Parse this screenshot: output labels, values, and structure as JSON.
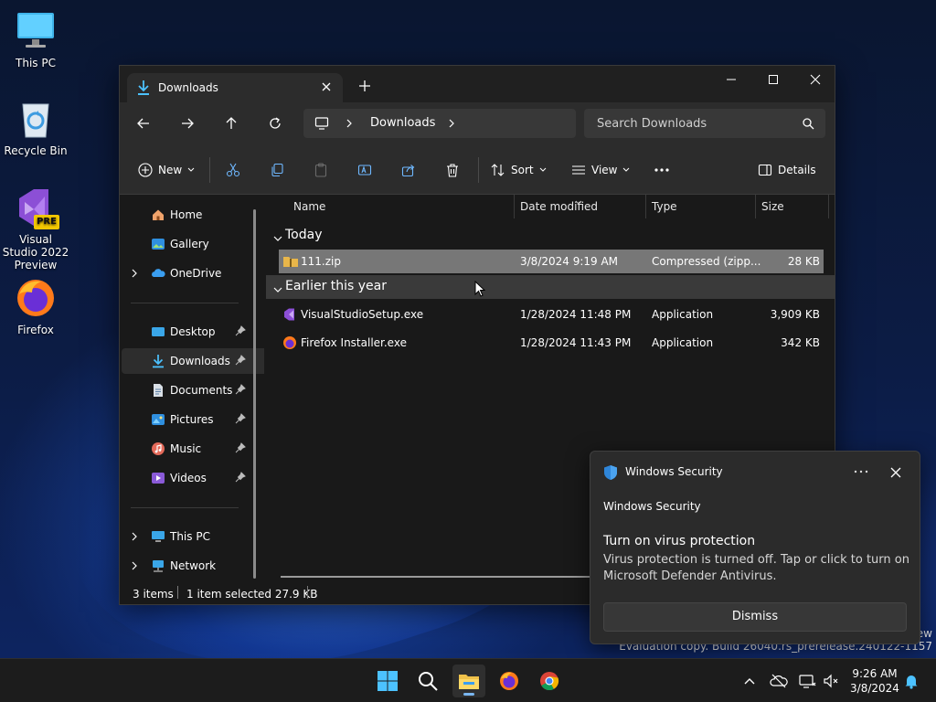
{
  "desktop": {
    "icons": [
      {
        "label": "This PC"
      },
      {
        "label": "Recycle Bin"
      },
      {
        "label": "Visual Studio 2022 Preview",
        "badge": "PRE"
      },
      {
        "label": "Firefox"
      }
    ],
    "watermark": {
      "line1": "ew",
      "line2": "Evaluation copy. Build 26040.rs_prerelease.240122-1157"
    }
  },
  "explorer": {
    "tab": {
      "title": "Downloads"
    },
    "address": {
      "segment": "Downloads"
    },
    "search": {
      "placeholder": "Search Downloads"
    },
    "toolbar": {
      "new_label": "New",
      "sort_label": "Sort",
      "view_label": "View",
      "details_label": "Details"
    },
    "nav": {
      "items": [
        {
          "label": "Home",
          "icon": "home-icon"
        },
        {
          "label": "Gallery",
          "icon": "gallery-icon"
        },
        {
          "label": "OneDrive",
          "icon": "onedrive-icon"
        },
        {
          "label": "Desktop",
          "icon": "desktop-icon"
        },
        {
          "label": "Downloads",
          "icon": "download-icon"
        },
        {
          "label": "Documents",
          "icon": "documents-icon"
        },
        {
          "label": "Pictures",
          "icon": "pictures-icon"
        },
        {
          "label": "Music",
          "icon": "music-icon"
        },
        {
          "label": "Videos",
          "icon": "videos-icon"
        },
        {
          "label": "This PC",
          "icon": "pc-icon"
        },
        {
          "label": "Network",
          "icon": "network-icon"
        }
      ]
    },
    "columns": {
      "name": "Name",
      "date": "Date modified",
      "type": "Type",
      "size": "Size"
    },
    "groups": [
      {
        "label": "Today",
        "files": [
          {
            "name": "111.zip",
            "date": "3/8/2024 9:19 AM",
            "type": "Compressed (zipp...",
            "size": "28 KB",
            "icon": "zip-folder-icon"
          }
        ]
      },
      {
        "label": "Earlier this year",
        "files": [
          {
            "name": "VisualStudioSetup.exe",
            "date": "1/28/2024 11:48 PM",
            "type": "Application",
            "size": "3,909 KB",
            "icon": "visual-studio-icon"
          },
          {
            "name": "Firefox Installer.exe",
            "date": "1/28/2024 11:43 PM",
            "type": "Application",
            "size": "342 KB",
            "icon": "firefox-icon"
          }
        ]
      }
    ],
    "status": {
      "count": "3 items",
      "selected": "1 item selected  27.9 KB"
    }
  },
  "toast": {
    "app": "Windows Security",
    "subtitle": "Windows Security",
    "title": "Turn on virus protection",
    "body": "Virus protection is turned off. Tap or click to turn on Microsoft Defender Antivirus.",
    "dismiss_label": "Dismiss"
  },
  "taskbar": {
    "clock": {
      "time": "9:26 AM",
      "date": "3/8/2024"
    }
  },
  "colors": {
    "accent": "#4cc2ff",
    "selection": "#777777",
    "window_bg": "#191919",
    "toolbar_bg": "#2c2c2c"
  }
}
